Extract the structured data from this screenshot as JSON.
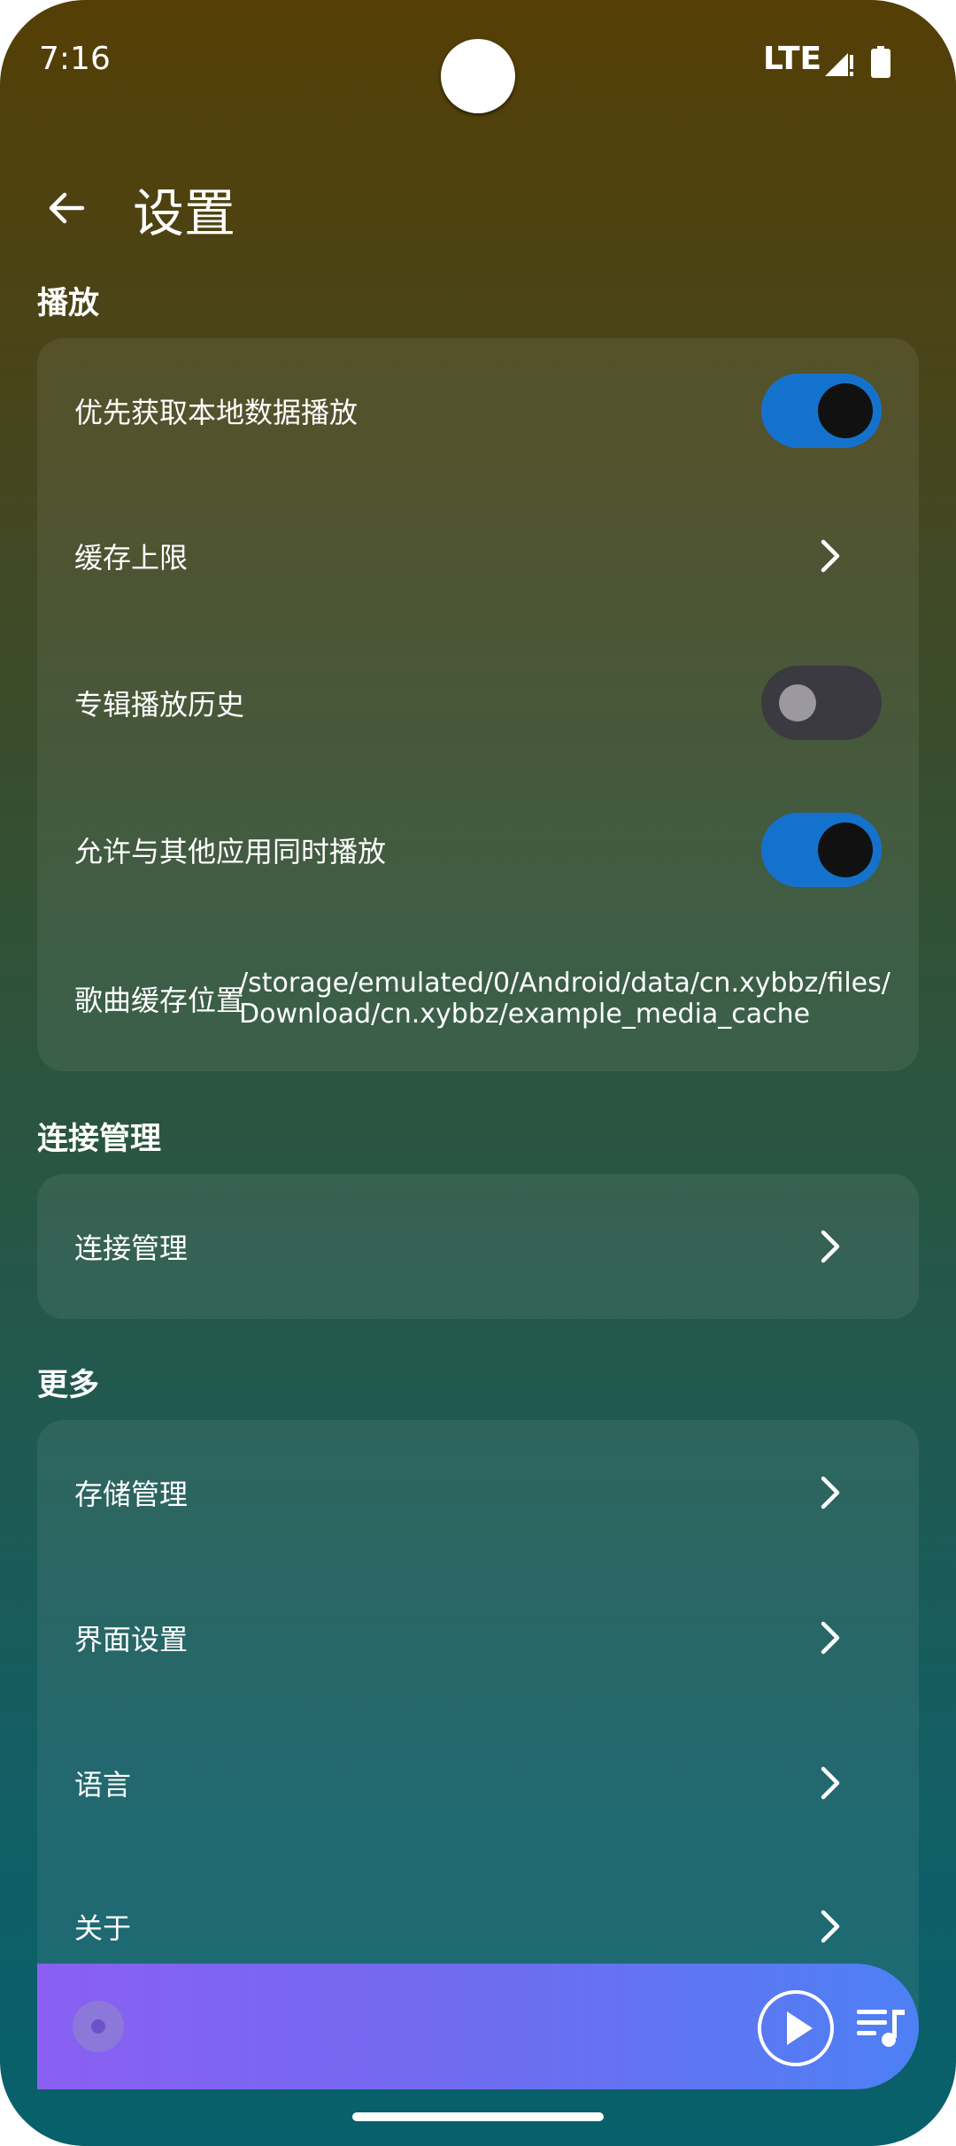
{
  "status_bar": {
    "time": "7:16",
    "network": "LTE"
  },
  "header": {
    "title": "设置"
  },
  "sections": {
    "playback": {
      "title": "播放",
      "items": [
        {
          "label": "优先获取本地数据播放",
          "type": "toggle",
          "on": true
        },
        {
          "label": "缓存上限",
          "type": "link"
        },
        {
          "label": "专辑播放历史",
          "type": "toggle",
          "on": false
        },
        {
          "label": "允许与其他应用同时播放",
          "type": "toggle",
          "on": true
        },
        {
          "label": "歌曲缓存位置",
          "type": "value",
          "value": "/storage/emulated/0/Android/data/cn.xybbz/files/\nDownload/cn.xybbz/example_media_cache"
        }
      ]
    },
    "connection": {
      "title": "连接管理",
      "items": [
        {
          "label": "连接管理",
          "type": "link"
        }
      ]
    },
    "more": {
      "title": "更多",
      "items": [
        {
          "label": "存储管理",
          "type": "link"
        },
        {
          "label": "界面设置",
          "type": "link"
        },
        {
          "label": "语言",
          "type": "link"
        },
        {
          "label": "关于",
          "type": "link"
        }
      ]
    }
  },
  "player": {
    "icons": [
      "album-disc-icon",
      "play-icon",
      "queue-music-icon"
    ]
  },
  "colors": {
    "toggle_on": "#1572cc",
    "toggle_off": "#3a3a40",
    "player_gradient_start": "#8a5ff2",
    "player_gradient_end": "#4d80f4"
  }
}
